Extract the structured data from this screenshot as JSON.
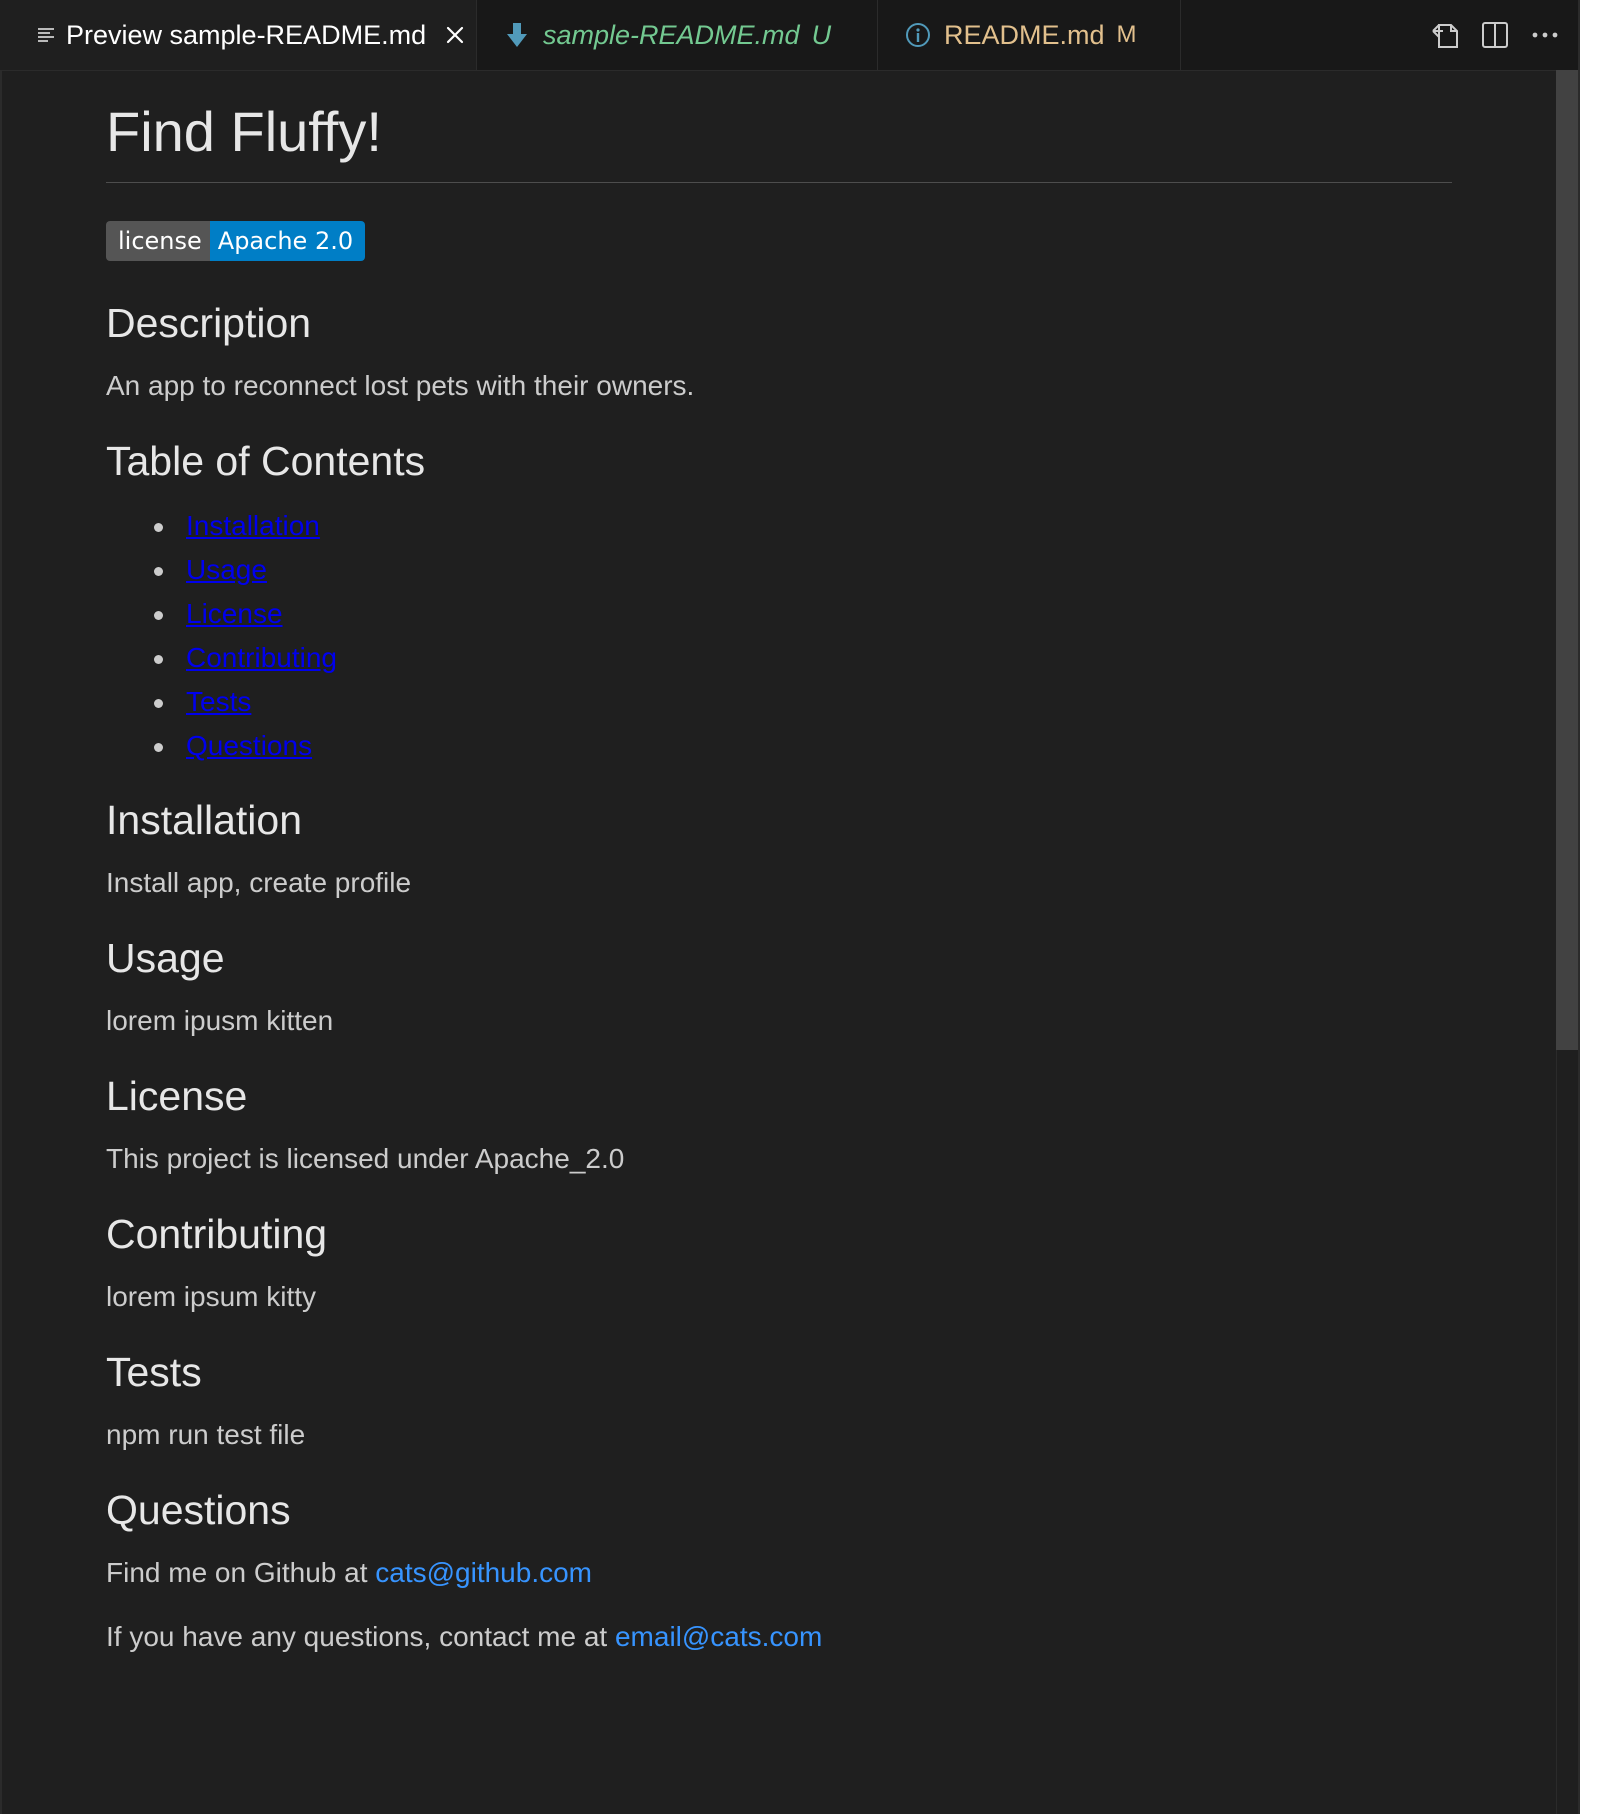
{
  "tabs": [
    {
      "label": "Preview sample-README.md",
      "icon": "preview-lines-icon",
      "state": "active"
    },
    {
      "label": "sample-README.md",
      "badge": "U",
      "icon": "markdown-arrow-icon",
      "state": "untracked"
    },
    {
      "label": "README.md",
      "badge": "M",
      "icon": "info-icon",
      "state": "modified"
    }
  ],
  "colors": {
    "background": "#1f1f1f",
    "link": "#3794ff",
    "untracked": "#73c991",
    "modified": "#e2c08d",
    "badge_key": "#555555",
    "badge_value": "#007ec6"
  },
  "preview": {
    "title": "Find Fluffy!",
    "badge": {
      "key": "license",
      "value": "Apache 2.0"
    },
    "description": {
      "heading": "Description",
      "text": "An app to reconnect lost pets with their owners."
    },
    "toc": {
      "heading": "Table of Contents",
      "items": [
        "Installation",
        "Usage",
        "License",
        "Contributing",
        "Tests",
        "Questions"
      ]
    },
    "installation": {
      "heading": "Installation",
      "text": "Install app, create profile"
    },
    "usage": {
      "heading": "Usage",
      "text": "lorem ipusm kitten"
    },
    "license": {
      "heading": "License",
      "text": "This project is licensed under Apache_2.0"
    },
    "contributing": {
      "heading": "Contributing",
      "text": "lorem ipsum kitty"
    },
    "tests": {
      "heading": "Tests",
      "text": "npm run test file"
    },
    "questions": {
      "heading": "Questions",
      "github_prefix": "Find me on Github at ",
      "github_link": "cats@github.com",
      "email_prefix": "If you have any questions, contact me at ",
      "email_link": "email@cats.com"
    }
  }
}
